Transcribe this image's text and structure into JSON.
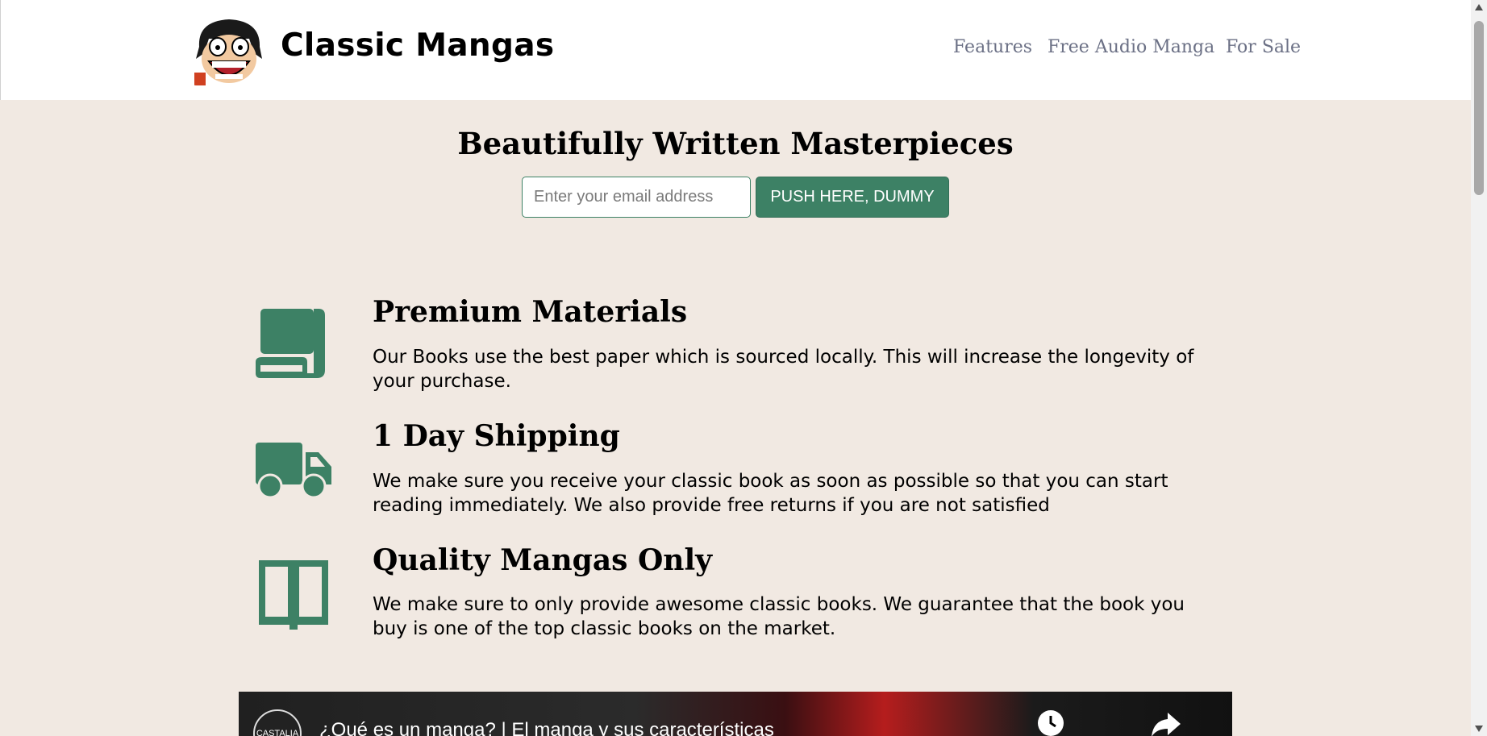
{
  "header": {
    "brand": "Classic Mangas",
    "nav": [
      "Features",
      "Free Audio Manga",
      "For Sale"
    ]
  },
  "hero": {
    "title": "Beautifully Written Masterpieces",
    "email_placeholder": "Enter your email address",
    "button_label": "PUSH HERE, DUMMY"
  },
  "features": [
    {
      "icon": "book-icon",
      "title": "Premium Materials",
      "text": "Our Books use the best paper which is sourced locally. This will increase the longevity of your purchase."
    },
    {
      "icon": "truck-icon",
      "title": "1 Day Shipping",
      "text": "We make sure you receive your classic book as soon as possible so that you can start reading immediately. We also provide free returns if you are not satisfied"
    },
    {
      "icon": "open-book-icon",
      "title": "Quality Mangas Only",
      "text": "We make sure to only provide awesome classic books. We guarantee that the book you buy is one of the top classic books on the market."
    }
  ],
  "video": {
    "channel": "CASTALIA",
    "title": "¿Qué es un manga? | El manga y sus características"
  },
  "colors": {
    "accent": "#3d8165",
    "page_bg": "#f1e9e2",
    "nav_text": "#6b7085"
  }
}
